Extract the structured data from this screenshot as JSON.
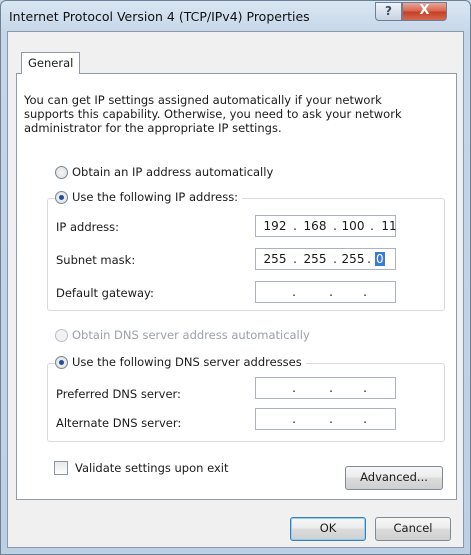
{
  "window": {
    "title": "Internet Protocol Version 4 (TCP/IPv4) Properties",
    "help_label": "?",
    "close_label": "X"
  },
  "tab": {
    "label": "General"
  },
  "intro_text": "You can get IP settings assigned automatically if your network supports this capability. Otherwise, you need to ask your network administrator for the appropriate IP settings.",
  "ip": {
    "auto_label": "Obtain an IP address automatically",
    "manual_label": "Use the following IP address:",
    "fields": {
      "ip_address": {
        "label": "IP address:",
        "octets": [
          "192",
          "168",
          "100",
          "11"
        ]
      },
      "subnet_mask": {
        "label": "Subnet mask:",
        "octets": [
          "255",
          "255",
          "255",
          "0"
        ]
      },
      "default_gateway": {
        "label": "Default gateway:",
        "octets": [
          "",
          "",
          "",
          ""
        ]
      }
    }
  },
  "dns": {
    "auto_label": "Obtain DNS server address automatically",
    "manual_label": "Use the following DNS server addresses",
    "fields": {
      "preferred": {
        "label": "Preferred DNS server:",
        "octets": [
          "",
          "",
          "",
          ""
        ]
      },
      "alternate": {
        "label": "Alternate DNS server:",
        "octets": [
          "",
          "",
          "",
          ""
        ]
      }
    }
  },
  "validate_label": "Validate settings upon exit",
  "buttons": {
    "advanced": "Advanced...",
    "ok": "OK",
    "cancel": "Cancel"
  },
  "dot": "."
}
